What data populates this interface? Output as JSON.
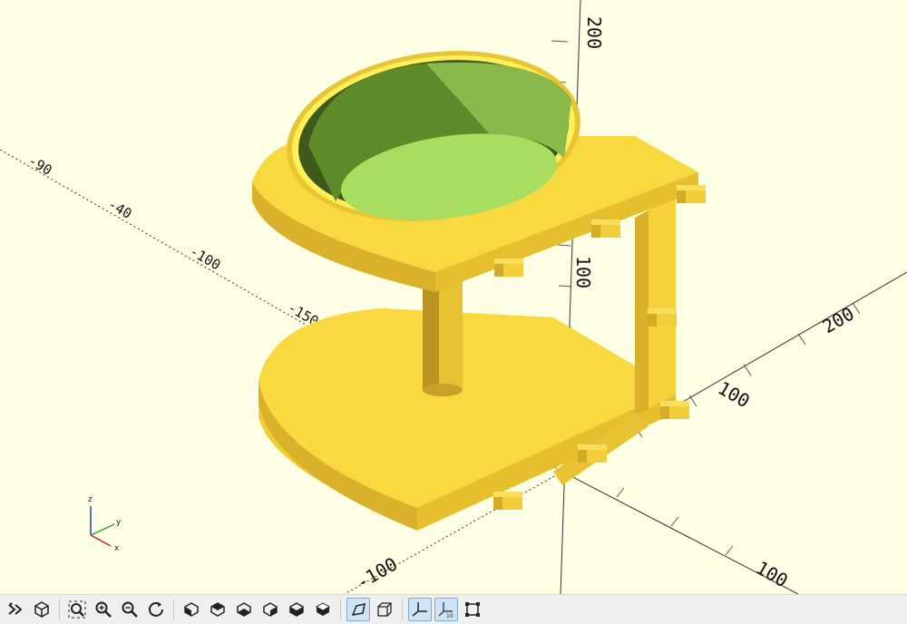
{
  "app": "OpenSCAD",
  "viewport": {
    "background": "#ffffe5",
    "model_color": "#f8d83a",
    "inner_color": "#9ccc55",
    "axis_labels": {
      "z_top": "200",
      "z_mid": "100",
      "x_neg": "-90",
      "x_neg2": "-40",
      "x_neg3": "-100",
      "x_neg4": "-150",
      "y_pos": "100",
      "y_neg": "-100",
      "x_pos": "100",
      "x_pos2": "200"
    },
    "gizmo": {
      "z": "z",
      "y": "y",
      "x": "x"
    }
  },
  "toolbar": {
    "buttons": [
      {
        "name": "preview-icon",
        "active": false
      },
      {
        "name": "render-icon",
        "active": false
      },
      {
        "name": "view-all-icon",
        "active": false
      },
      {
        "name": "zoom-in-icon",
        "active": false
      },
      {
        "name": "zoom-out-icon",
        "active": false
      },
      {
        "name": "reset-view-icon",
        "active": false
      },
      {
        "name": "view-right-icon",
        "active": false
      },
      {
        "name": "view-top-icon",
        "active": false
      },
      {
        "name": "view-bottom-icon",
        "active": false
      },
      {
        "name": "view-left-icon",
        "active": false
      },
      {
        "name": "view-front-icon",
        "active": false
      },
      {
        "name": "view-back-icon",
        "active": false
      },
      {
        "name": "perspective-icon",
        "active": true
      },
      {
        "name": "orthogonal-icon",
        "active": false
      },
      {
        "name": "show-axes-icon",
        "active": true
      },
      {
        "name": "show-scale-icon",
        "active": true
      },
      {
        "name": "show-edges-icon",
        "active": false
      }
    ],
    "scale_marker": "10"
  }
}
